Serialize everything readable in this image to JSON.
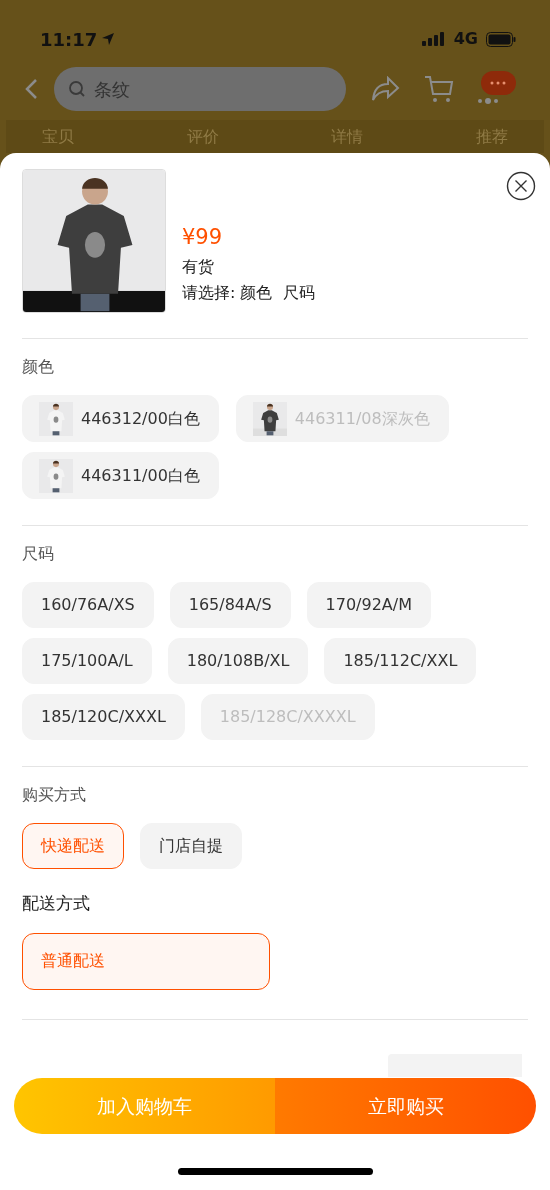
{
  "status_bar": {
    "time": "11:17",
    "network": "4G"
  },
  "search": {
    "placeholder": "条纹"
  },
  "tabs": [
    {
      "label": "宝贝"
    },
    {
      "label": "评价"
    },
    {
      "label": "详情"
    },
    {
      "label": "推荐"
    }
  ],
  "product": {
    "price": "¥99",
    "stock": "有货",
    "prompt": "请选择: 颜色  尺码"
  },
  "sections": [
    {
      "title": "颜色",
      "kind": "swatch",
      "options": [
        {
          "label": "446312/00白色",
          "selected": false,
          "disabled": false
        },
        {
          "label": "446311/08深灰色",
          "selected": false,
          "disabled": true
        },
        {
          "label": "446311/00白色",
          "selected": false,
          "disabled": false
        }
      ]
    },
    {
      "title": "尺码",
      "kind": "chip",
      "options": [
        {
          "label": "160/76A/XS",
          "selected": false,
          "disabled": false
        },
        {
          "label": "165/84A/S",
          "selected": false,
          "disabled": false
        },
        {
          "label": "170/92A/M",
          "selected": false,
          "disabled": false
        },
        {
          "label": "175/100A/L",
          "selected": false,
          "disabled": false
        },
        {
          "label": "180/108B/XL",
          "selected": false,
          "disabled": false
        },
        {
          "label": "185/112C/XXL",
          "selected": false,
          "disabled": false
        },
        {
          "label": "185/120C/XXXL",
          "selected": false,
          "disabled": false
        },
        {
          "label": "185/128C/XXXXL",
          "selected": false,
          "disabled": true
        }
      ]
    },
    {
      "title": "购买方式",
      "kind": "chip",
      "options": [
        {
          "label": "快递配送",
          "selected": true,
          "disabled": false
        },
        {
          "label": "门店自提",
          "selected": false,
          "disabled": false
        }
      ]
    },
    {
      "title": "配送方式",
      "kind": "wide",
      "options": [
        {
          "label": "普通配送",
          "selected": true,
          "disabled": false
        }
      ]
    }
  ],
  "actions": [
    {
      "label": "加入购物车",
      "kind": "cart"
    },
    {
      "label": "立即购买",
      "kind": "buy"
    }
  ]
}
